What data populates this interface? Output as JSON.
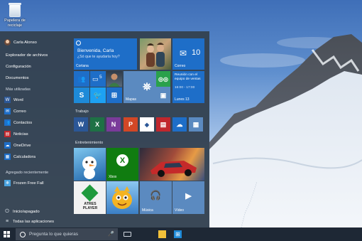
{
  "desktop": {
    "recycle_bin_label": "Papelera de reciclaje"
  },
  "start_menu": {
    "user": {
      "name": "Carla Alonso"
    },
    "places": [
      {
        "label": "Explorador de archivos"
      },
      {
        "label": "Configuración"
      },
      {
        "label": "Documentos"
      }
    ],
    "most_used_header": "Más utilizadas",
    "most_used": [
      {
        "label": "Word",
        "icon": "word-icon",
        "color": "#2b5797"
      },
      {
        "label": "Correo",
        "icon": "mail-icon",
        "color": "#1e6ec8"
      },
      {
        "label": "Contactos",
        "icon": "people-icon",
        "color": "#1e6ec8"
      },
      {
        "label": "Noticias",
        "icon": "news-icon",
        "color": "#c1272d"
      },
      {
        "label": "OneDrive",
        "icon": "cloud-icon",
        "color": "#1e6ec8"
      },
      {
        "label": "Calculadora",
        "icon": "calculator-icon",
        "color": "#1e6ec8"
      }
    ],
    "recently_added_header": "Agregado recientemente",
    "recently_added": [
      {
        "label": "Frozen Free Fall",
        "icon": "frozen-icon",
        "color": "#4aa3df"
      }
    ],
    "power_label": "Inicio/apagado",
    "all_apps_label": "Todas las aplicaciones",
    "tiles": {
      "cortana": {
        "greeting": "Bienvenida, Carla",
        "question": "¿Só que te ayudaría hoy?",
        "label": "Cortana"
      },
      "mail": {
        "count": "10",
        "label": "Correo"
      },
      "calendar": {
        "event": "Reunión con el equipo de ventas",
        "time": "16:00 - 17:00",
        "label": "Lunes 13"
      },
      "maps_label": "Mapas",
      "people_badge": "5",
      "group_work": "Trabajo",
      "group_entertainment": "Entretenimiento",
      "xbox_label": "Xbox",
      "music_label": "Música",
      "video_label": "Vídeo",
      "atres_label": "ATRES PLAYER"
    }
  },
  "taskbar": {
    "search_placeholder": "Pregunta lo que quieras"
  },
  "colors": {
    "tile_blue": "#1e6ec8",
    "tile_light": "#5b8ac0",
    "start_bg": "#344252",
    "taskbar_bg": "#1e2835"
  }
}
